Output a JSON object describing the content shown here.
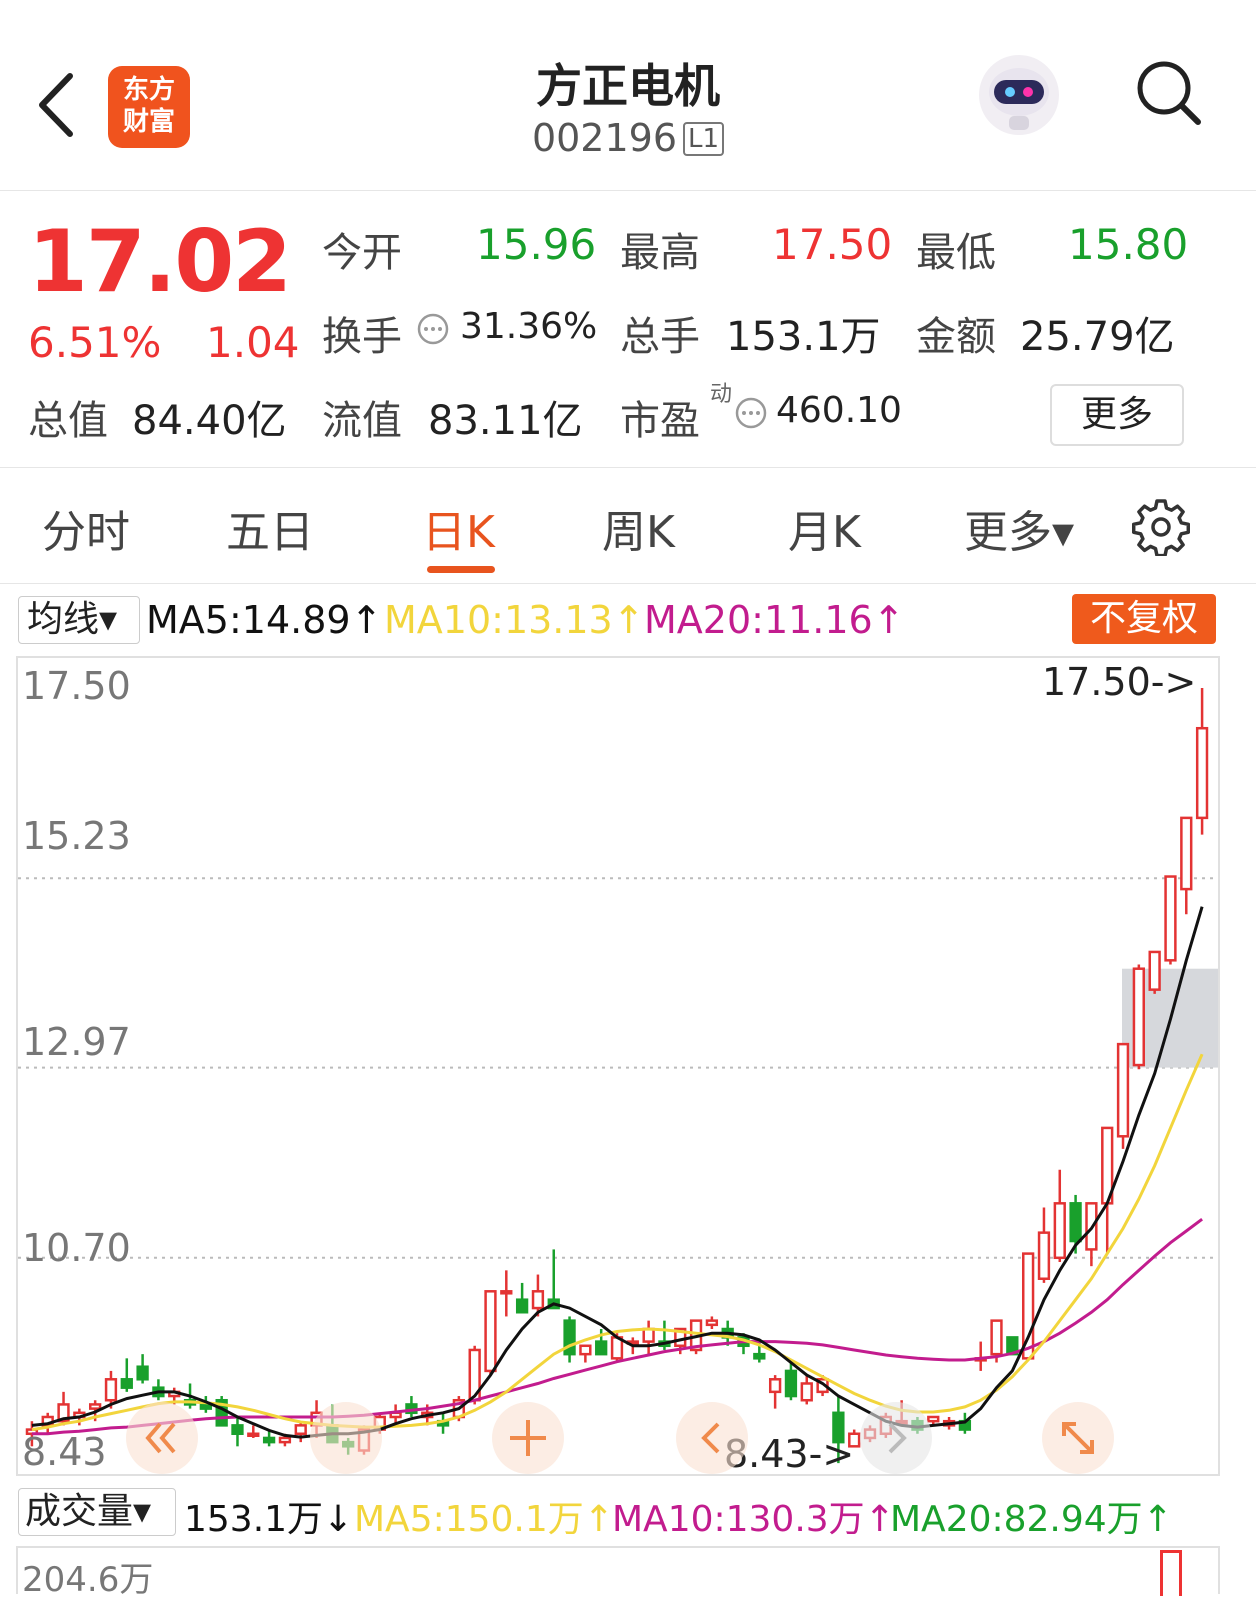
{
  "header": {
    "logo_line1": "东方",
    "logo_line2": "财富",
    "title": "方正电机",
    "code": "002196",
    "level": "L1"
  },
  "quote": {
    "price": "17.02",
    "change_pct": "6.51%",
    "change": "1.04",
    "open_label": "今开",
    "open": "15.96",
    "high_label": "最高",
    "high": "17.50",
    "low_label": "最低",
    "low": "15.80",
    "turnover_label": "换手",
    "turnover": "31.36%",
    "volume_label": "总手",
    "volume": "153.1万",
    "amount_label": "金额",
    "amount": "25.79亿",
    "mktcap_label": "总值",
    "mktcap": "84.40亿",
    "float_label": "流值",
    "float": "83.11亿",
    "pe_label": "市盈",
    "pe_sup": "动",
    "pe": "460.10",
    "more": "更多"
  },
  "tabs": [
    "分时",
    "五日",
    "日K",
    "周K",
    "月K",
    "更多▾"
  ],
  "active_tab": "日K",
  "ma": {
    "select": "均线▾",
    "ma5": "MA5:14.89↑",
    "ma10": "MA10:13.13↑",
    "ma20": "MA20:11.16↑",
    "adjust": "不复权",
    "colors": {
      "ma5": "#111111",
      "ma10": "#f2d53c",
      "ma20": "#c21c8e",
      "up": "#e33333",
      "down": "#19a02c"
    }
  },
  "chart_data": {
    "type": "candlestick",
    "y_ticks": [
      "17.50",
      "15.23",
      "12.97",
      "10.70",
      "8.43"
    ],
    "ylim": [
      8.43,
      17.5
    ],
    "max_marker": "17.50->",
    "min_marker": "8.43->",
    "candles": [
      [
        8.6,
        8.75,
        8.45,
        8.65
      ],
      [
        8.7,
        8.85,
        8.6,
        8.8
      ],
      [
        8.75,
        9.1,
        8.7,
        8.95
      ],
      [
        8.8,
        8.9,
        8.7,
        8.85
      ],
      [
        8.9,
        9.0,
        8.75,
        8.95
      ],
      [
        9.0,
        9.35,
        8.9,
        9.25
      ],
      [
        9.25,
        9.5,
        9.1,
        9.15
      ],
      [
        9.4,
        9.55,
        9.2,
        9.25
      ],
      [
        9.15,
        9.25,
        9.0,
        9.05
      ],
      [
        9.05,
        9.15,
        8.95,
        9.1
      ],
      [
        9.0,
        9.2,
        8.9,
        8.95
      ],
      [
        8.95,
        9.05,
        8.85,
        8.9
      ],
      [
        9.0,
        9.05,
        8.75,
        8.7
      ],
      [
        8.7,
        8.8,
        8.45,
        8.6
      ],
      [
        8.6,
        8.7,
        8.55,
        8.6
      ],
      [
        8.55,
        8.65,
        8.45,
        8.5
      ],
      [
        8.5,
        8.6,
        8.45,
        8.55
      ],
      [
        8.6,
        8.75,
        8.5,
        8.7
      ],
      [
        8.7,
        9.0,
        8.55,
        8.85
      ],
      [
        8.7,
        8.95,
        8.5,
        8.5
      ],
      [
        8.5,
        8.55,
        8.35,
        8.45
      ],
      [
        8.4,
        8.7,
        8.35,
        8.65
      ],
      [
        8.65,
        8.85,
        8.6,
        8.8
      ],
      [
        8.8,
        8.95,
        8.7,
        8.85
      ],
      [
        8.95,
        9.05,
        8.8,
        8.85
      ],
      [
        8.8,
        8.95,
        8.7,
        8.85
      ],
      [
        8.75,
        8.85,
        8.6,
        8.7
      ],
      [
        8.8,
        9.05,
        8.75,
        9.0
      ],
      [
        9.0,
        9.65,
        8.95,
        9.6
      ],
      [
        9.35,
        10.3,
        9.3,
        10.3
      ],
      [
        10.3,
        10.55,
        10.0,
        10.3
      ],
      [
        10.2,
        10.4,
        10.05,
        10.05
      ],
      [
        10.1,
        10.5,
        10.0,
        10.3
      ],
      [
        10.2,
        10.8,
        10.1,
        10.1
      ],
      [
        9.95,
        10.0,
        9.45,
        9.55
      ],
      [
        9.55,
        9.65,
        9.45,
        9.65
      ],
      [
        9.7,
        9.85,
        9.55,
        9.55
      ],
      [
        9.5,
        9.8,
        9.45,
        9.75
      ],
      [
        9.7,
        9.75,
        9.55,
        9.7
      ],
      [
        9.7,
        9.95,
        9.55,
        9.85
      ],
      [
        9.7,
        9.95,
        9.6,
        9.65
      ],
      [
        9.65,
        9.85,
        9.55,
        9.85
      ],
      [
        9.6,
        9.95,
        9.55,
        9.95
      ],
      [
        9.9,
        10.0,
        9.85,
        9.95
      ],
      [
        9.85,
        9.95,
        9.65,
        9.75
      ],
      [
        9.75,
        9.8,
        9.55,
        9.65
      ],
      [
        9.55,
        9.7,
        9.45,
        9.5
      ],
      [
        9.1,
        9.3,
        8.9,
        9.25
      ],
      [
        9.35,
        9.45,
        9.0,
        9.05
      ],
      [
        9.0,
        9.3,
        8.95,
        9.2
      ],
      [
        9.1,
        9.3,
        9.05,
        9.25
      ],
      [
        8.85,
        9.05,
        8.25,
        8.5
      ],
      [
        8.45,
        8.65,
        8.45,
        8.6
      ],
      [
        8.55,
        8.7,
        8.5,
        8.65
      ],
      [
        8.6,
        8.85,
        8.55,
        8.8
      ],
      [
        8.75,
        9.0,
        8.7,
        8.75
      ],
      [
        8.75,
        8.8,
        8.6,
        8.65
      ],
      [
        8.75,
        8.8,
        8.7,
        8.8
      ],
      [
        8.7,
        8.8,
        8.65,
        8.75
      ],
      [
        8.75,
        8.85,
        8.6,
        8.65
      ],
      [
        9.5,
        9.7,
        9.35,
        9.5
      ],
      [
        9.55,
        9.95,
        9.45,
        9.95
      ],
      [
        9.75,
        9.7,
        9.55,
        9.55
      ],
      [
        9.5,
        10.7,
        9.5,
        10.75
      ],
      [
        10.45,
        11.3,
        10.4,
        11.0
      ],
      [
        10.7,
        11.75,
        10.65,
        11.35
      ],
      [
        11.35,
        11.45,
        10.75,
        10.9
      ],
      [
        10.8,
        11.35,
        10.6,
        11.35
      ],
      [
        11.35,
        11.75,
        10.75,
        12.25
      ],
      [
        12.15,
        13.25,
        12.0,
        13.25
      ],
      [
        13.0,
        14.2,
        12.95,
        14.15
      ],
      [
        13.9,
        14.2,
        13.85,
        14.35
      ],
      [
        14.25,
        15.25,
        14.2,
        15.25
      ],
      [
        15.1,
        15.95,
        14.8,
        15.95
      ],
      [
        15.95,
        17.5,
        15.75,
        17.02
      ]
    ],
    "ma5": [
      8.7,
      8.72,
      8.78,
      8.8,
      8.86,
      8.95,
      9.02,
      9.06,
      9.1,
      9.1,
      9.05,
      8.98,
      8.9,
      8.8,
      8.72,
      8.64,
      8.58,
      8.56,
      8.58,
      8.6,
      8.6,
      8.62,
      8.65,
      8.72,
      8.78,
      8.82,
      8.85,
      8.9,
      9.05,
      9.3,
      9.6,
      9.85,
      10.05,
      10.15,
      10.1,
      10.0,
      9.9,
      9.75,
      9.65,
      9.65,
      9.68,
      9.72,
      9.76,
      9.8,
      9.8,
      9.78,
      9.72,
      9.6,
      9.45,
      9.3,
      9.2,
      9.05,
      8.95,
      8.85,
      8.75,
      8.7,
      8.68,
      8.7,
      8.72,
      8.74,
      8.9,
      9.15,
      9.35,
      9.75,
      10.2,
      10.55,
      10.85,
      11.05,
      11.35,
      11.85,
      12.4,
      12.9,
      13.55,
      14.25,
      14.89
    ],
    "ma10": [
      8.65,
      8.68,
      8.72,
      8.75,
      8.8,
      8.84,
      8.88,
      8.92,
      8.96,
      8.98,
      8.98,
      8.97,
      8.95,
      8.92,
      8.88,
      8.83,
      8.78,
      8.74,
      8.72,
      8.7,
      8.69,
      8.68,
      8.68,
      8.69,
      8.7,
      8.72,
      8.75,
      8.8,
      8.88,
      8.98,
      9.1,
      9.25,
      9.4,
      9.55,
      9.65,
      9.72,
      9.78,
      9.82,
      9.84,
      9.85,
      9.84,
      9.82,
      9.8,
      9.78,
      9.76,
      9.72,
      9.66,
      9.58,
      9.48,
      9.38,
      9.28,
      9.18,
      9.08,
      9.0,
      8.93,
      8.88,
      8.86,
      8.86,
      8.88,
      8.92,
      9.0,
      9.12,
      9.28,
      9.48,
      9.7,
      9.95,
      10.2,
      10.45,
      10.75,
      11.05,
      11.4,
      11.8,
      12.25,
      12.7,
      13.13
    ],
    "ma20": [
      8.6,
      8.6,
      8.62,
      8.63,
      8.65,
      8.67,
      8.68,
      8.7,
      8.72,
      8.74,
      8.76,
      8.78,
      8.79,
      8.8,
      8.8,
      8.8,
      8.8,
      8.8,
      8.8,
      8.8,
      8.81,
      8.82,
      8.84,
      8.86,
      8.88,
      8.9,
      8.93,
      8.96,
      9.0,
      9.05,
      9.1,
      9.15,
      9.2,
      9.26,
      9.31,
      9.36,
      9.41,
      9.46,
      9.5,
      9.54,
      9.58,
      9.61,
      9.64,
      9.66,
      9.68,
      9.7,
      9.7,
      9.7,
      9.69,
      9.68,
      9.66,
      9.63,
      9.6,
      9.57,
      9.54,
      9.52,
      9.5,
      9.49,
      9.48,
      9.48,
      9.5,
      9.52,
      9.56,
      9.62,
      9.7,
      9.8,
      9.92,
      10.05,
      10.2,
      10.38,
      10.55,
      10.72,
      10.88,
      11.02,
      11.16
    ]
  },
  "volume": {
    "select": "成交量▾",
    "value": "153.1万↓",
    "ma5": "MA5:150.1万↑",
    "ma10": "MA10:130.3万↑",
    "ma20": "MA20:82.94万↑",
    "axis_top": "204.6万"
  }
}
